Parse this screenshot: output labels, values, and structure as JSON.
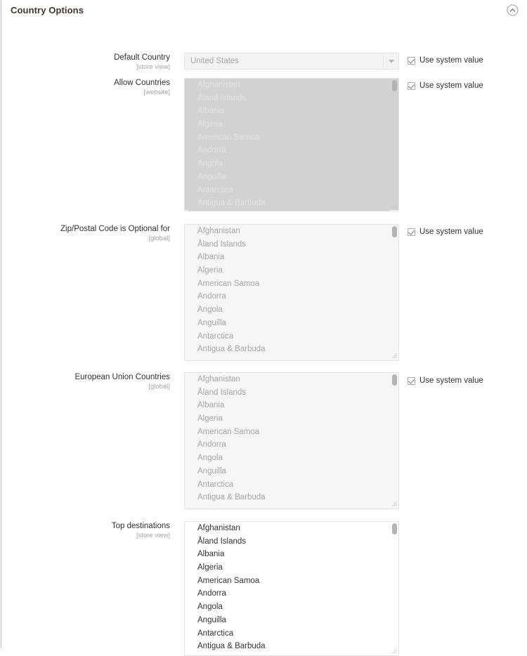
{
  "section": {
    "title": "Country Options",
    "collapse_icon": "chevron-up-circle-icon",
    "collapsed": false
  },
  "common": {
    "use_system_value_label": "Use system value",
    "checkbox_checked": true,
    "dropdown_arrow_icon": "chevron-down-icon",
    "resize_handle_icon": "resize-grip-icon",
    "scrollbar_icon": "vertical-scrollbar"
  },
  "country_options": [
    "Afghanistan",
    "Åland Islands",
    "Albania",
    "Algeria",
    "American Samoa",
    "Andorra",
    "Angola",
    "Anguilla",
    "Antarctica",
    "Antigua & Barbuda"
  ],
  "fields": {
    "default_country": {
      "label": "Default Country",
      "scope": "[store view]",
      "value": "United States",
      "control": "select",
      "disabled": true,
      "use_system_value": "Use system value"
    },
    "allow_countries": {
      "label": "Allow Countries",
      "scope": "[website]",
      "control": "multiselect",
      "state": "all-selected",
      "disabled": true,
      "use_system_value": "Use system value"
    },
    "zip_optional": {
      "label": "Zip/Postal Code is Optional for",
      "scope": "[global]",
      "control": "multiselect",
      "state": "disabled",
      "disabled": true,
      "use_system_value": "Use system value"
    },
    "eu_countries": {
      "label": "European Union Countries",
      "scope": "[global]",
      "control": "multiselect",
      "state": "disabled",
      "disabled": true,
      "use_system_value": "Use system value"
    },
    "top_destinations": {
      "label": "Top destinations",
      "scope": "[store view]",
      "control": "multiselect",
      "state": "enabled",
      "disabled": false
    }
  }
}
